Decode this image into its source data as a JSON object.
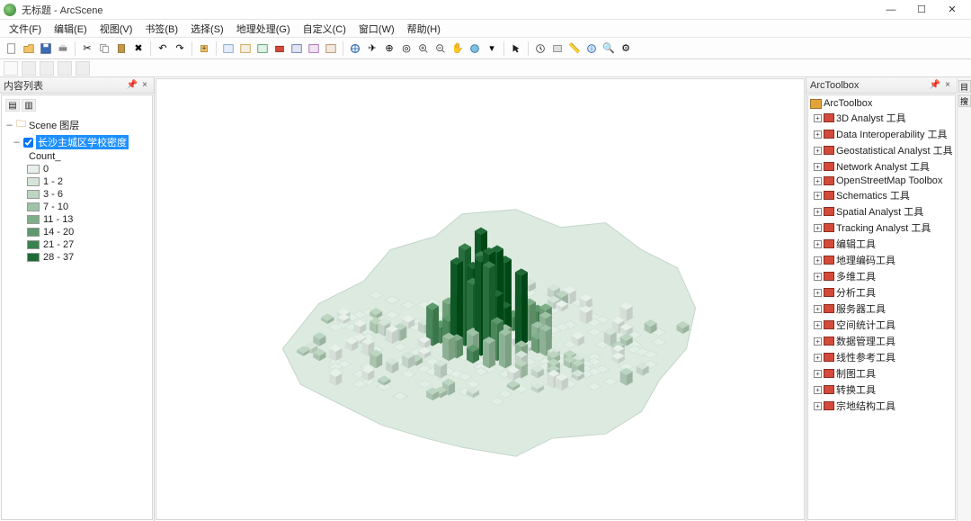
{
  "window": {
    "title": "无标题 - ArcScene"
  },
  "menu": {
    "file": "文件(F)",
    "edit": "编辑(E)",
    "view": "视图(V)",
    "bookmarks": "书签(B)",
    "select": "选择(S)",
    "geoproc": "地理处理(G)",
    "custom": "自定义(C)",
    "window": "窗口(W)",
    "help": "帮助(H)"
  },
  "toc": {
    "title": "内容列表",
    "scene_label": "Scene 图层",
    "layer_name": "长沙主城区学校密度",
    "field_label": "Count_",
    "legend": [
      {
        "label": "0",
        "color": "#e8f0ea"
      },
      {
        "label": "1 - 2",
        "color": "#d6e5d9"
      },
      {
        "label": "3 - 6",
        "color": "#bcd6c1"
      },
      {
        "label": "7 - 10",
        "color": "#9fc3a6"
      },
      {
        "label": "11 - 13",
        "color": "#7faf89"
      },
      {
        "label": "14 - 20",
        "color": "#5d996c"
      },
      {
        "label": "21 - 27",
        "color": "#3a814f"
      },
      {
        "label": "28 - 37",
        "color": "#206a38"
      }
    ]
  },
  "arctoolbox": {
    "title": "ArcToolbox",
    "root": "ArcToolbox",
    "items": [
      "3D Analyst 工具",
      "Data Interoperability 工具",
      "Geostatistical Analyst 工具",
      "Network Analyst 工具",
      "OpenStreetMap Toolbox",
      "Schematics 工具",
      "Spatial Analyst 工具",
      "Tracking Analyst 工具",
      "编辑工具",
      "地理编码工具",
      "多维工具",
      "分析工具",
      "服务器工具",
      "空间统计工具",
      "数据管理工具",
      "线性参考工具",
      "制图工具",
      "转换工具",
      "宗地结构工具"
    ]
  }
}
